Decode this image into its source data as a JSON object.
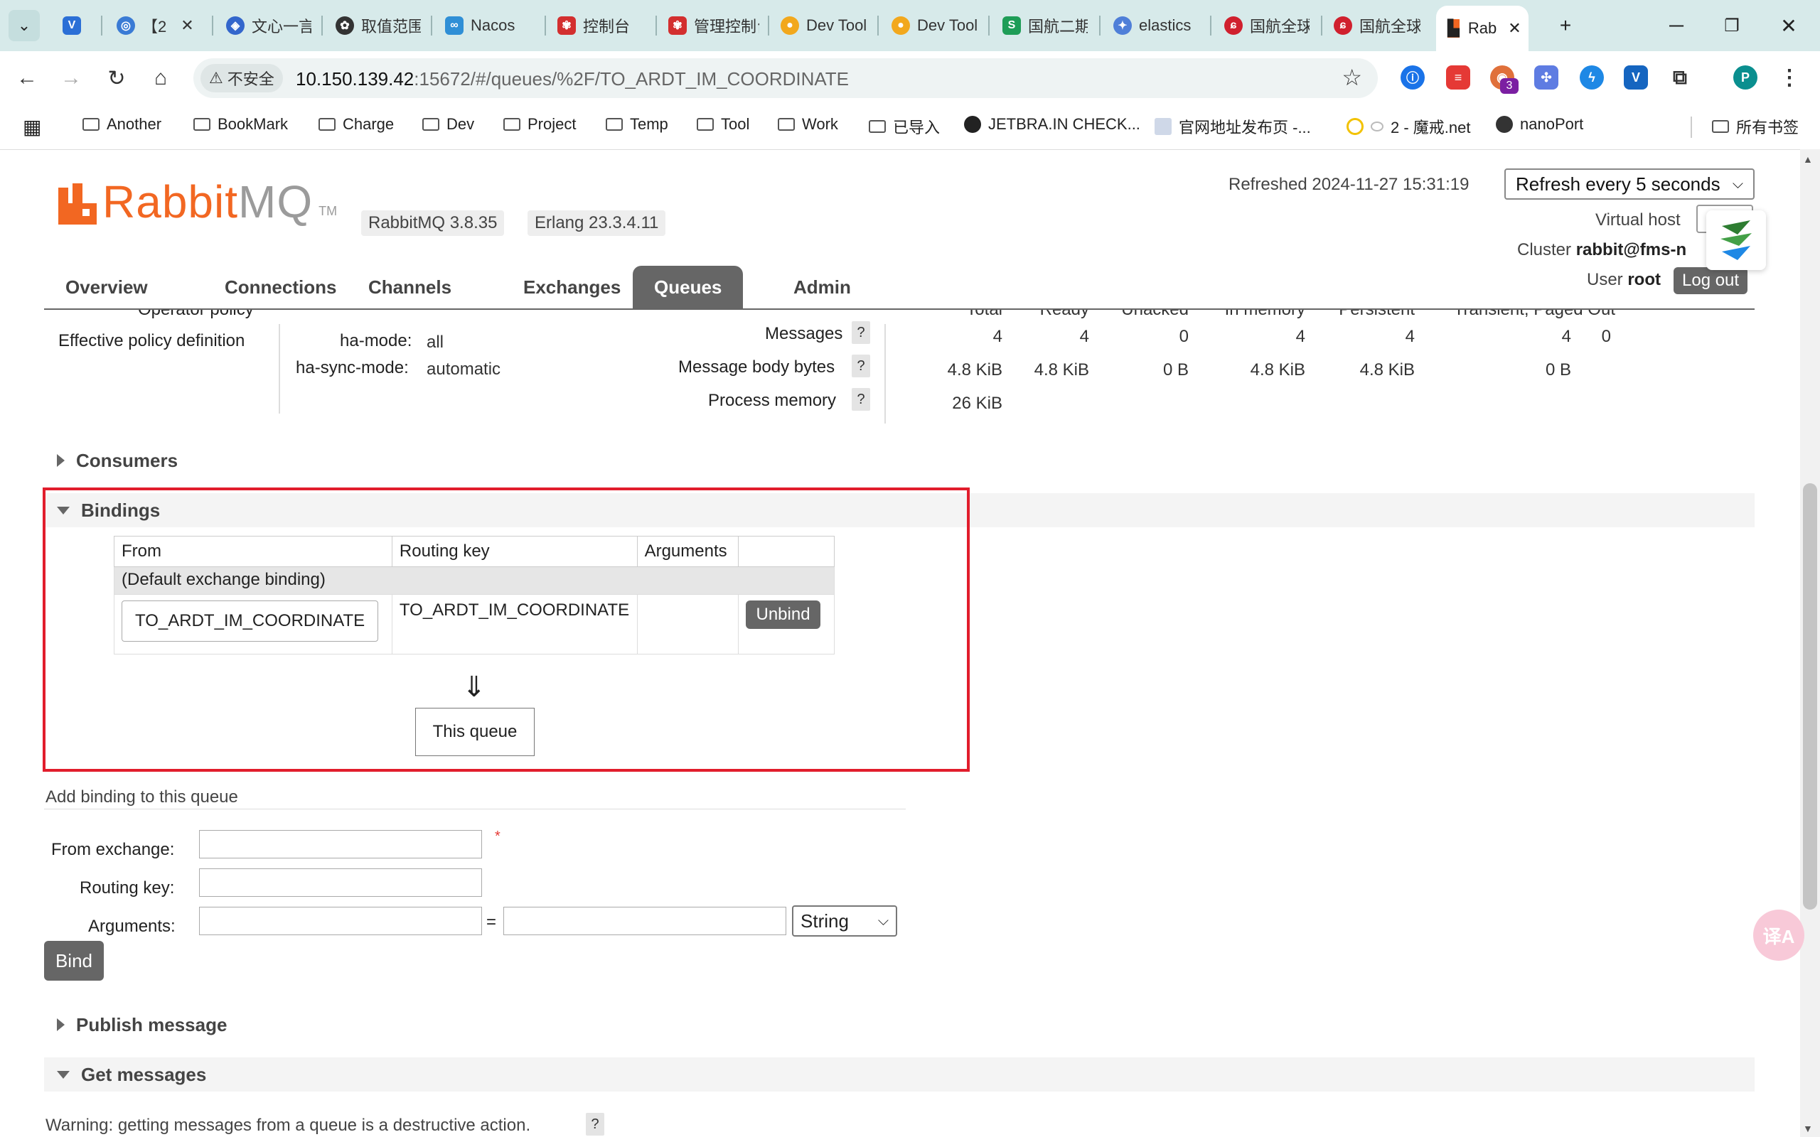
{
  "browser": {
    "tabs": [
      {
        "label": "",
        "icon": "v-logo-icon",
        "color": "#2b6fd6"
      },
      {
        "label": "【2",
        "icon": "globe-icon",
        "color": "#3a7bd5"
      },
      {
        "label": "文心一言",
        "icon": "wenxin-icon",
        "color": "#3366cc"
      },
      {
        "label": "取值范围",
        "icon": "openai-icon",
        "color": "#333333"
      },
      {
        "label": "Nacos",
        "icon": "nacos-icon",
        "color": "#2f8fd6"
      },
      {
        "label": "控制台",
        "icon": "huawei-icon",
        "color": "#d32f2f"
      },
      {
        "label": "管理控制台",
        "icon": "huawei-icon",
        "color": "#d32f2f"
      },
      {
        "label": "Dev Tools",
        "icon": "devtools-icon",
        "color": "#f2a81d"
      },
      {
        "label": "Dev Tools",
        "icon": "devtools-icon",
        "color": "#f2a81d"
      },
      {
        "label": "国航二期",
        "icon": "sheet-icon",
        "color": "#1e9d57"
      },
      {
        "label": "elastics",
        "icon": "elastic-icon",
        "color": "#4f7fd8"
      },
      {
        "label": "国航全球",
        "icon": "airchina-icon",
        "color": "#d0202e"
      },
      {
        "label": "国航全球",
        "icon": "airchina-icon",
        "color": "#d0202e"
      }
    ],
    "active_tab": {
      "label": "Rab",
      "icon": "rabbitmq-icon"
    },
    "insecure_label": "不安全",
    "url_host": "10.150.139.42",
    "url_rest": ":15672/#/queues/%2F/TO_ARDT_IM_COORDINATE",
    "extension_badge": "3",
    "profile_initial": "P",
    "bookmarks": [
      "Another",
      "BookMark",
      "Charge",
      "Dev",
      "Project",
      "Temp",
      "Tool",
      "Work",
      "已导入"
    ],
    "bookmark_links": [
      "JETBRA.IN CHECK...",
      "官网地址发布页 -...",
      "2 - 魔戒.net",
      "nanoPort"
    ],
    "all_bookmarks": "所有书签"
  },
  "rabbit": {
    "logo_rabbit": "Rabbit",
    "logo_mq": "MQ",
    "logo_tm": "TM",
    "version": "RabbitMQ 3.8.35",
    "erlang": "Erlang 23.3.4.11",
    "refreshed_label": "Refreshed 2024-11-27 15:31:19",
    "refresh_option": "Refresh every 5 seconds",
    "vhost_label": "Virtual host",
    "cluster_label": "Cluster",
    "cluster_value": "rabbit@fms-n",
    "user_label": "User",
    "user_value": "root",
    "logout": "Log out",
    "nav": [
      "Overview",
      "Connections",
      "Channels",
      "Exchanges",
      "Queues",
      "Admin"
    ],
    "active_nav": "Queues"
  },
  "details": {
    "operator_policy": "Operator policy",
    "effective_policy": "Effective policy definition",
    "ha_mode_key": "ha-mode:",
    "ha_mode_val": "all",
    "ha_sync_key": "ha-sync-mode:",
    "ha_sync_val": "automatic",
    "col_headers": [
      "Total",
      "Ready",
      "Unacked",
      "In memory",
      "Persistent",
      "Transient, Paged Out"
    ],
    "messages_label": "Messages",
    "messages": [
      "4",
      "4",
      "0",
      "4",
      "4",
      "4",
      "0"
    ],
    "body_bytes_label": "Message body bytes",
    "body_bytes": [
      "4.8 KiB",
      "4.8 KiB",
      "0 B",
      "4.8 KiB",
      "4.8 KiB",
      "0 B"
    ],
    "process_memory_label": "Process memory",
    "process_memory": "26 KiB",
    "help": "?"
  },
  "sections": {
    "consumers": "Consumers",
    "bindings": "Bindings",
    "publish": "Publish message",
    "get": "Get messages"
  },
  "bindings": {
    "headers": [
      "From",
      "Routing key",
      "Arguments",
      ""
    ],
    "default_row": "(Default exchange binding)",
    "from": "TO_ARDT_IM_COORDINATE",
    "routing_key": "TO_ARDT_IM_COORDINATE",
    "arguments": "",
    "unbind": "Unbind",
    "arrow": "⇓",
    "this_queue": "This queue"
  },
  "add_binding": {
    "title": "Add binding to this queue",
    "from_exchange_label": "From exchange:",
    "required_mark": "*",
    "routing_key_label": "Routing key:",
    "arguments_label": "Arguments:",
    "equals": "=",
    "type_option": "String",
    "bind_button": "Bind"
  },
  "get_messages": {
    "warning": "Warning: getting messages from a queue is a destructive action."
  },
  "translate_fab": "译A"
}
